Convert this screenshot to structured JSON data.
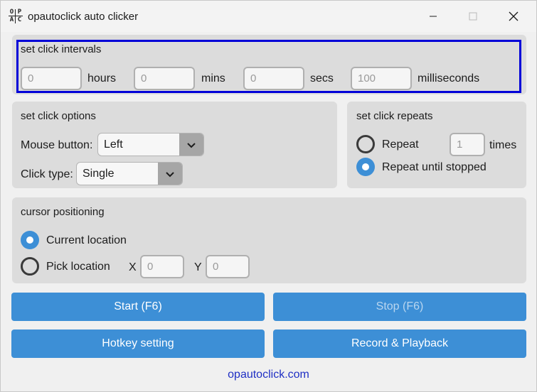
{
  "window": {
    "title": "opautoclick auto clicker",
    "icon_letters": [
      "O",
      "P",
      "A",
      "C"
    ]
  },
  "intervals": {
    "title": "set click intervals",
    "fields": [
      {
        "value": "0",
        "unit": "hours"
      },
      {
        "value": "0",
        "unit": "mins"
      },
      {
        "value": "0",
        "unit": "secs"
      },
      {
        "value": "100",
        "unit": "milliseconds"
      }
    ]
  },
  "options": {
    "title": "set click options",
    "mouse_button_label": "Mouse button:",
    "mouse_button_value": "Left",
    "click_type_label": "Click type:",
    "click_type_value": "Single"
  },
  "repeats": {
    "title": "set click repeats",
    "repeat_label": "Repeat",
    "repeat_count": "1",
    "times_label": "times",
    "until_stopped_label": "Repeat until stopped",
    "selected": "until_stopped"
  },
  "cursor": {
    "title": "cursor positioning",
    "current_label": "Current location",
    "pick_label": "Pick location",
    "x_label": "X",
    "x_value": "0",
    "y_label": "Y",
    "y_value": "0",
    "selected": "current"
  },
  "buttons": {
    "start": "Start (F6)",
    "stop": "Stop (F6)",
    "hotkey": "Hotkey setting",
    "record": "Record & Playback"
  },
  "footer": {
    "link": "opautoclick.com"
  },
  "colors": {
    "accent": "#3d8fd6",
    "highlight_border": "#0000d8",
    "panel": "#dcdcdc",
    "link": "#1f2fc4"
  },
  "icons": [
    "app-logo-icon",
    "minimize-icon",
    "maximize-icon",
    "close-icon",
    "chevron-down-icon"
  ]
}
